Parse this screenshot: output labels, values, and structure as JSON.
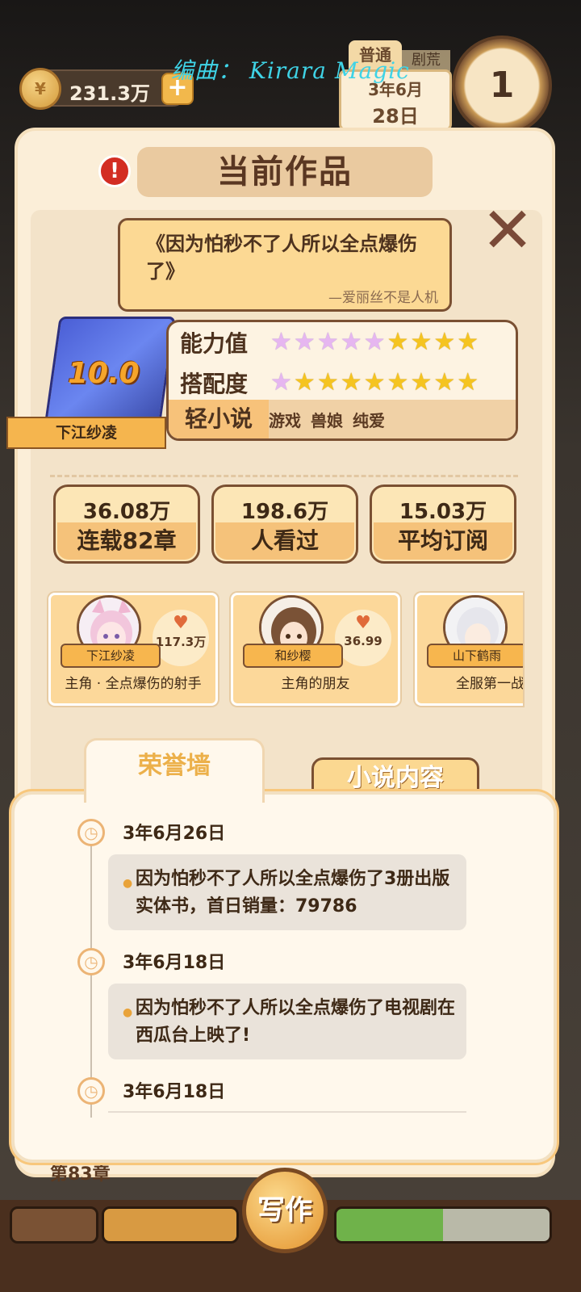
{
  "hud": {
    "coins": "231.3万",
    "coin_symbol": "¥",
    "add_symbol": "+",
    "credit": "编曲： Kirara Magic",
    "mode": "普通",
    "mode2": "剧荒",
    "date_month": "3年6月",
    "date_day": "28日",
    "clock_value": "1"
  },
  "panel": {
    "alert_symbol": "!",
    "title": "当前作品",
    "close_symbol": "✕"
  },
  "work": {
    "title": "《因为怕秒不了人所以全点爆伤了》",
    "author_line": "—爱丽丝不是人机",
    "score": "10.0",
    "author_ribbon": "下江纱凌",
    "ability_label": "能力值",
    "ability_stars": {
      "rainbow": 5,
      "gold": 4
    },
    "match_label": "搭配度",
    "match_stars": {
      "rainbow": 1,
      "gold": 8
    },
    "genre": "轻小说",
    "tags": [
      "游戏",
      "兽娘",
      "纯爱"
    ]
  },
  "metrics": [
    {
      "value": "36.08万",
      "label": "连载82章"
    },
    {
      "value": "198.6万",
      "label": "人看过"
    },
    {
      "value": "15.03万",
      "label": "平均订阅"
    }
  ],
  "characters": [
    {
      "name": "下江纱凌",
      "likes": "117.3万",
      "role": "主角 · 全点爆伤的射手"
    },
    {
      "name": "和纱樱",
      "likes": "36.99",
      "role": "主角的朋友"
    },
    {
      "name": "山下鹤雨",
      "likes": "",
      "role": "全服第一战"
    }
  ],
  "tabs": {
    "honor": "荣誉墙",
    "content": "小说内容"
  },
  "events": [
    {
      "date": "3年6月26日",
      "text": "因为怕秒不了人所以全点爆伤了3册出版实体书，首日销量：79786"
    },
    {
      "date": "3年6月18日",
      "text": "因为怕秒不了人所以全点爆伤了电视剧在西瓜台上映了!"
    },
    {
      "date": "3年6月18日",
      "text": ""
    }
  ],
  "bottom": {
    "chapter": "第83章",
    "write": "写作"
  }
}
